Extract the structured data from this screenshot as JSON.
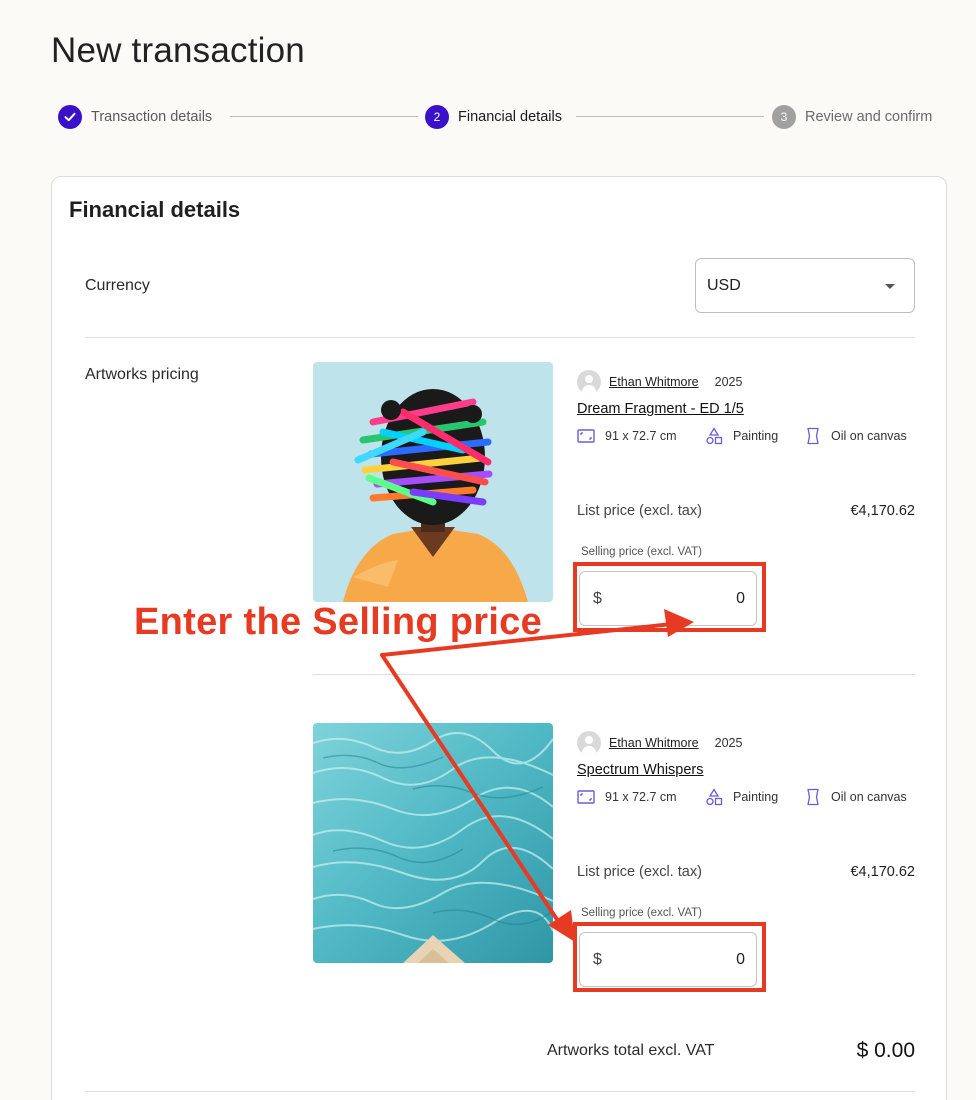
{
  "page": {
    "title": "New transaction"
  },
  "stepper": {
    "steps": [
      {
        "number": "1",
        "label": "Transaction details",
        "status": "completed"
      },
      {
        "number": "2",
        "label": "Financial details",
        "status": "active"
      },
      {
        "number": "3",
        "label": "Review and confirm",
        "status": "upcoming"
      }
    ]
  },
  "card": {
    "title": "Financial details",
    "currency": {
      "label": "Currency",
      "selected": "USD"
    },
    "pricing_label": "Artworks pricing",
    "artworks": [
      {
        "artist": "Ethan Whitmore",
        "year": "2025",
        "title": "Dream Fragment - ED 1/5",
        "dimensions": "91 x 72.7 cm",
        "category": "Painting",
        "medium": "Oil on canvas",
        "list_price_label": "List price (excl. tax)",
        "list_price": "€4,170.62",
        "selling_label": "Selling price (excl. VAT)",
        "currency_symbol": "$",
        "selling_value": "0"
      },
      {
        "artist": "Ethan Whitmore",
        "year": "2025",
        "title": "Spectrum Whispers",
        "dimensions": "91 x 72.7 cm",
        "category": "Painting",
        "medium": "Oil on canvas",
        "list_price_label": "List price (excl. tax)",
        "list_price": "€4,170.62",
        "selling_label": "Selling price (excl. VAT)",
        "currency_symbol": "$",
        "selling_value": "0"
      }
    ],
    "total": {
      "label": "Artworks total excl. VAT",
      "value": "$ 0.00"
    }
  },
  "annotation": {
    "text": "Enter the Selling price",
    "color": "#e63b22"
  },
  "colors": {
    "accent": "#3a10c9",
    "icon": "#6b5bd6",
    "inactive_step": "#a0a0a0"
  }
}
